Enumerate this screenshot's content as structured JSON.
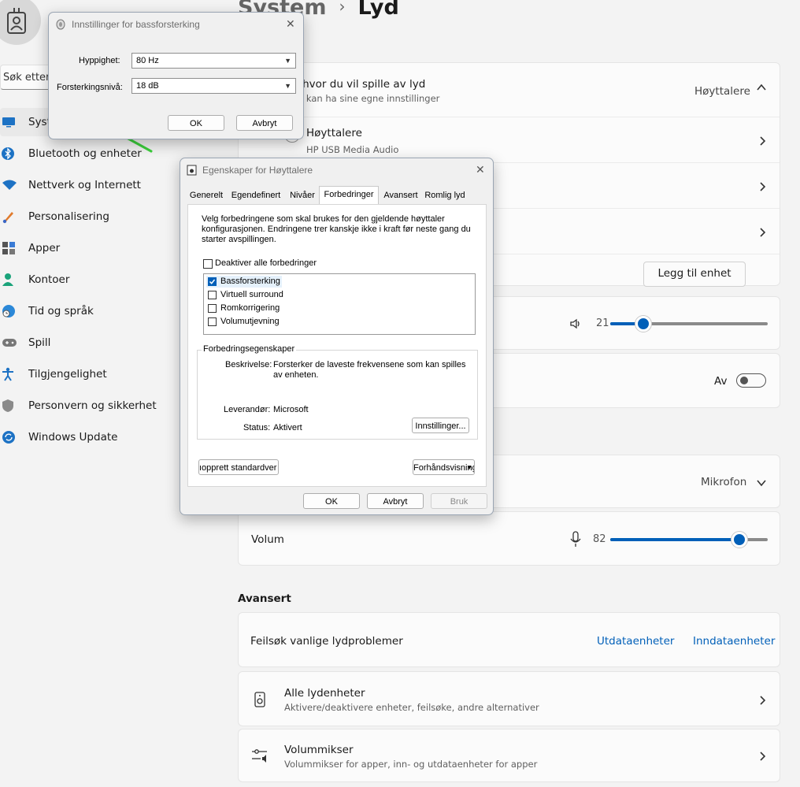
{
  "sidebar": {
    "search_placeholder": "Søk etter",
    "items": [
      {
        "label": "System",
        "icon": "monitor-icon"
      },
      {
        "label": "Bluetooth og enheter",
        "icon": "bluetooth-icon"
      },
      {
        "label": "Nettverk og Internett",
        "icon": "wifi-icon"
      },
      {
        "label": "Personalisering",
        "icon": "brush-icon"
      },
      {
        "label": "Apper",
        "icon": "apps-icon"
      },
      {
        "label": "Kontoer",
        "icon": "person-icon"
      },
      {
        "label": "Tid og språk",
        "icon": "globe-clock-icon"
      },
      {
        "label": "Spill",
        "icon": "gamepad-icon"
      },
      {
        "label": "Tilgjengelighet",
        "icon": "accessibility-icon"
      },
      {
        "label": "Personvern og sikkerhet",
        "icon": "shield-icon"
      },
      {
        "label": "Windows Update",
        "icon": "update-icon"
      }
    ]
  },
  "header": {
    "parent": "System",
    "separator": "›",
    "title": "Lyd"
  },
  "output": {
    "heading": "Velg hvor du vil spille av lyd",
    "subheading": "Apper kan ha sine egne innstillinger",
    "selected": "Høyttalere",
    "devices": [
      {
        "name": "Høyttalere",
        "desc": "HP USB Media Audio"
      }
    ],
    "add_device": "Legg til enhet",
    "volume_value": "21",
    "volume_level": 0.21,
    "mono_state": "Av"
  },
  "input": {
    "selected": "Mikrofon",
    "volume_label": "Volum",
    "volume_value": "82",
    "volume_level": 0.82
  },
  "advanced": {
    "heading": "Avansert",
    "troubleshoot_label": "Feilsøk vanlige lydproblemer",
    "output_link": "Utdataenheter",
    "input_link": "Inndataenheter",
    "all_devices_title": "Alle lydenheter",
    "all_devices_desc": "Aktivere/deaktivere enheter, feilsøke, andre alternativer",
    "mixer_title": "Volummikser",
    "mixer_desc": "Volummikser for apper, inn- og utdataenheter for apper"
  },
  "bass_dialog": {
    "title": "Innstillinger for bassforsterking",
    "frequency_label": "Hyppighet:",
    "frequency_value": "80 Hz",
    "level_label": "Forsterkingsnivå:",
    "level_value": "18 dB",
    "ok": "OK",
    "cancel": "Avbryt"
  },
  "props_dialog": {
    "title": "Egenskaper for Høyttalere",
    "tabs": [
      "Generelt",
      "Egendefinert",
      "Nivåer",
      "Forbedringer",
      "Avansert",
      "Romlig lyd"
    ],
    "active_tab": "Forbedringer",
    "intro": [
      "Velg forbedringene som skal brukes for den gjeldende høyttaler",
      "konfigurasjonen. Endringene trer kanskje ikke i kraft før neste gang du",
      "starter avspillingen."
    ],
    "disable_all": "Deaktiver alle forbedringer",
    "enhancements": [
      {
        "label": "Bassforsterking",
        "checked": true
      },
      {
        "label": "Virtuell surround",
        "checked": false
      },
      {
        "label": "Romkorrigering",
        "checked": false
      },
      {
        "label": "Volumutjevning",
        "checked": false
      }
    ],
    "group_title": "Forbedringsegenskaper",
    "desc_label": "Beskrivelse:",
    "desc_value": [
      "Forsterker de laveste frekvensene som kan spilles",
      "av enheten."
    ],
    "provider_label": "Leverandør:",
    "provider_value": "Microsoft",
    "status_label": "Status:",
    "status_value": "Aktivert",
    "settings_button": "Innstillinger...",
    "restore_button": "ıopprett standardver",
    "preview_button": "Forhåndsvisning",
    "ok": "OK",
    "cancel": "Avbryt",
    "apply": "Bruk"
  }
}
